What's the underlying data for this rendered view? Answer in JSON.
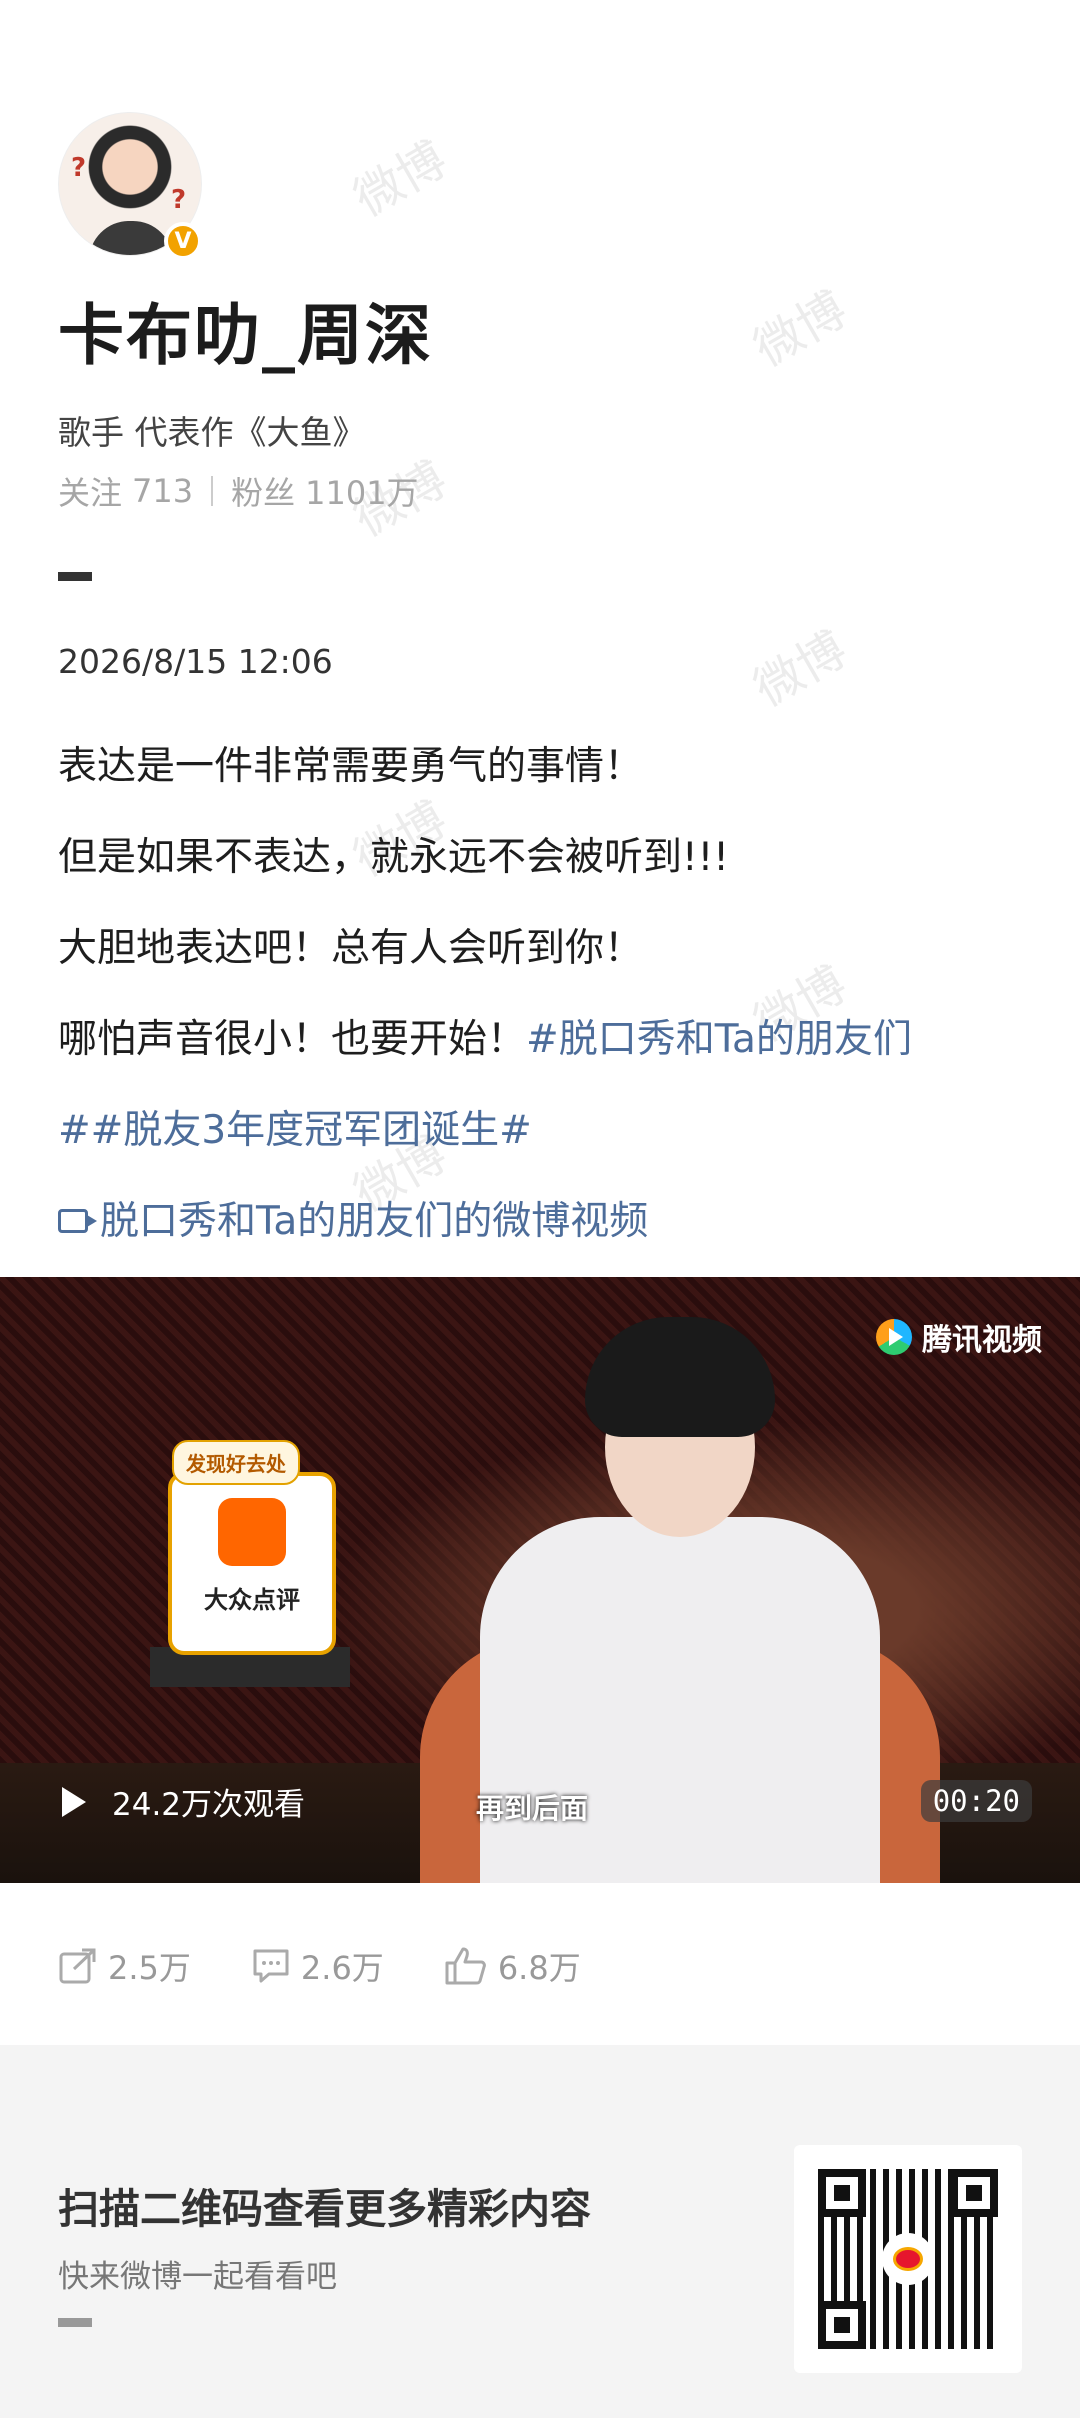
{
  "watermark": "微博",
  "profile": {
    "name": "卡布叻_周深",
    "verified_badge": "V",
    "bio": "歌手 代表作《大鱼》",
    "following_label": "关注",
    "following_count": "713",
    "followers_label": "粉丝",
    "followers_count": "1101万"
  },
  "post": {
    "timestamp": "2026/8/15 12:06",
    "lines": [
      "表达是一件非常需要勇气的事情！",
      "但是如果不表达，就永远不会被听到!!!",
      "大胆地表达吧！总有人会听到你！",
      "哪怕声音很小！也要开始！"
    ],
    "hashtag1": "#脱口秀和Ta的朋友们",
    "hashtag2": "##脱友3年度冠军团诞生#",
    "video_link": "脱口秀和Ta的朋友们的微博视频"
  },
  "video": {
    "platform_logo": "腾讯视频",
    "sign_tag": "发现好去处",
    "sign_brand": "大众点评",
    "views": "24.2万次观看",
    "subtitle": "再到后面",
    "duration": "00:20"
  },
  "actions": {
    "reposts": "2.5万",
    "comments": "2.6万",
    "likes": "6.8万"
  },
  "footer": {
    "title": "扫描二维码查看更多精彩内容",
    "subtitle": "快来微博一起看看吧"
  },
  "icons": [
    "verified-badge-icon",
    "repost-icon",
    "comment-icon",
    "like-icon",
    "video-link-icon",
    "play-icon",
    "qr-code-icon"
  ]
}
